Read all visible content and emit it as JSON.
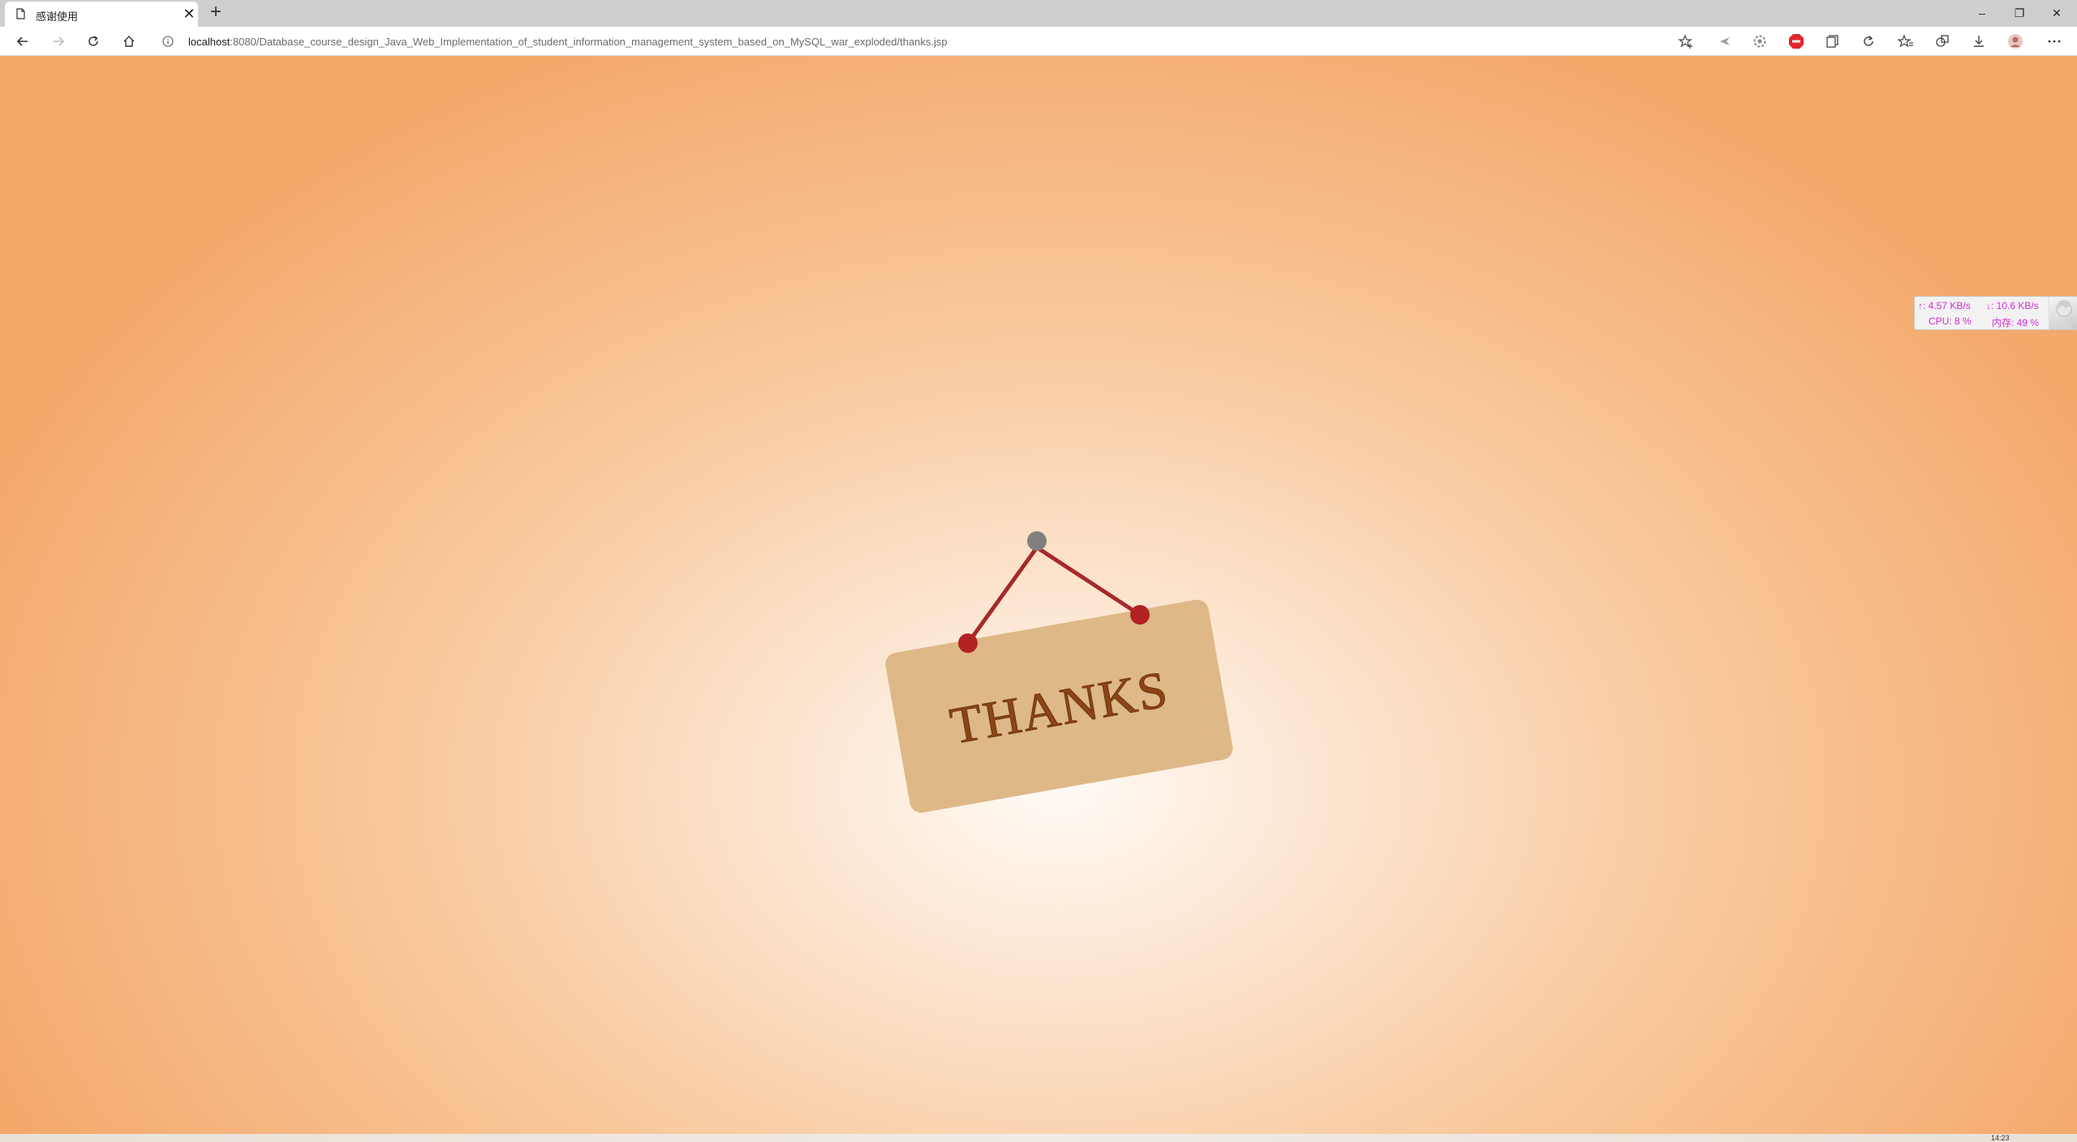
{
  "browser": {
    "tab": {
      "title": "感谢使用",
      "close_glyph": "✕",
      "icon": "page-icon"
    },
    "new_tab_glyph": "+",
    "window_controls": {
      "minimize": "–",
      "restore": "❐",
      "close": "✕"
    },
    "address": {
      "host": "localhost",
      "path": ":8080/Database_course_design_Java_Web_Implementation_of_student_information_management_system_based_on_MySQL_war_exploded/thanks.jsp",
      "info_icon": "info-icon"
    },
    "toolbar_icons": [
      "favorite-add-icon",
      "extension-arrow-icon",
      "extension-gear-icon",
      "adblock-icon",
      "collections-icon",
      "refresh-extension-icon",
      "favorites-icon",
      "tab-actions-icon",
      "downloads-icon",
      "profile-avatar-icon",
      "more-menu-icon"
    ]
  },
  "page": {
    "sign_text": "THANKS",
    "colors": {
      "sign_board": "#deb887",
      "sign_text": "#8b4513",
      "string": "#a52a2a",
      "nail_red": "#b22222",
      "pin_gray": "#808080",
      "bg_center": "#fffaf5",
      "bg_edge": "#f4a86a"
    }
  },
  "net_monitor": {
    "upload": "↑: 4.57 KB/s",
    "download": "↓: 10.6 KB/s",
    "cpu": "CPU: 8 %",
    "memory": "内存: 49 %"
  },
  "taskbar": {
    "clock_fragment": "14:23"
  }
}
